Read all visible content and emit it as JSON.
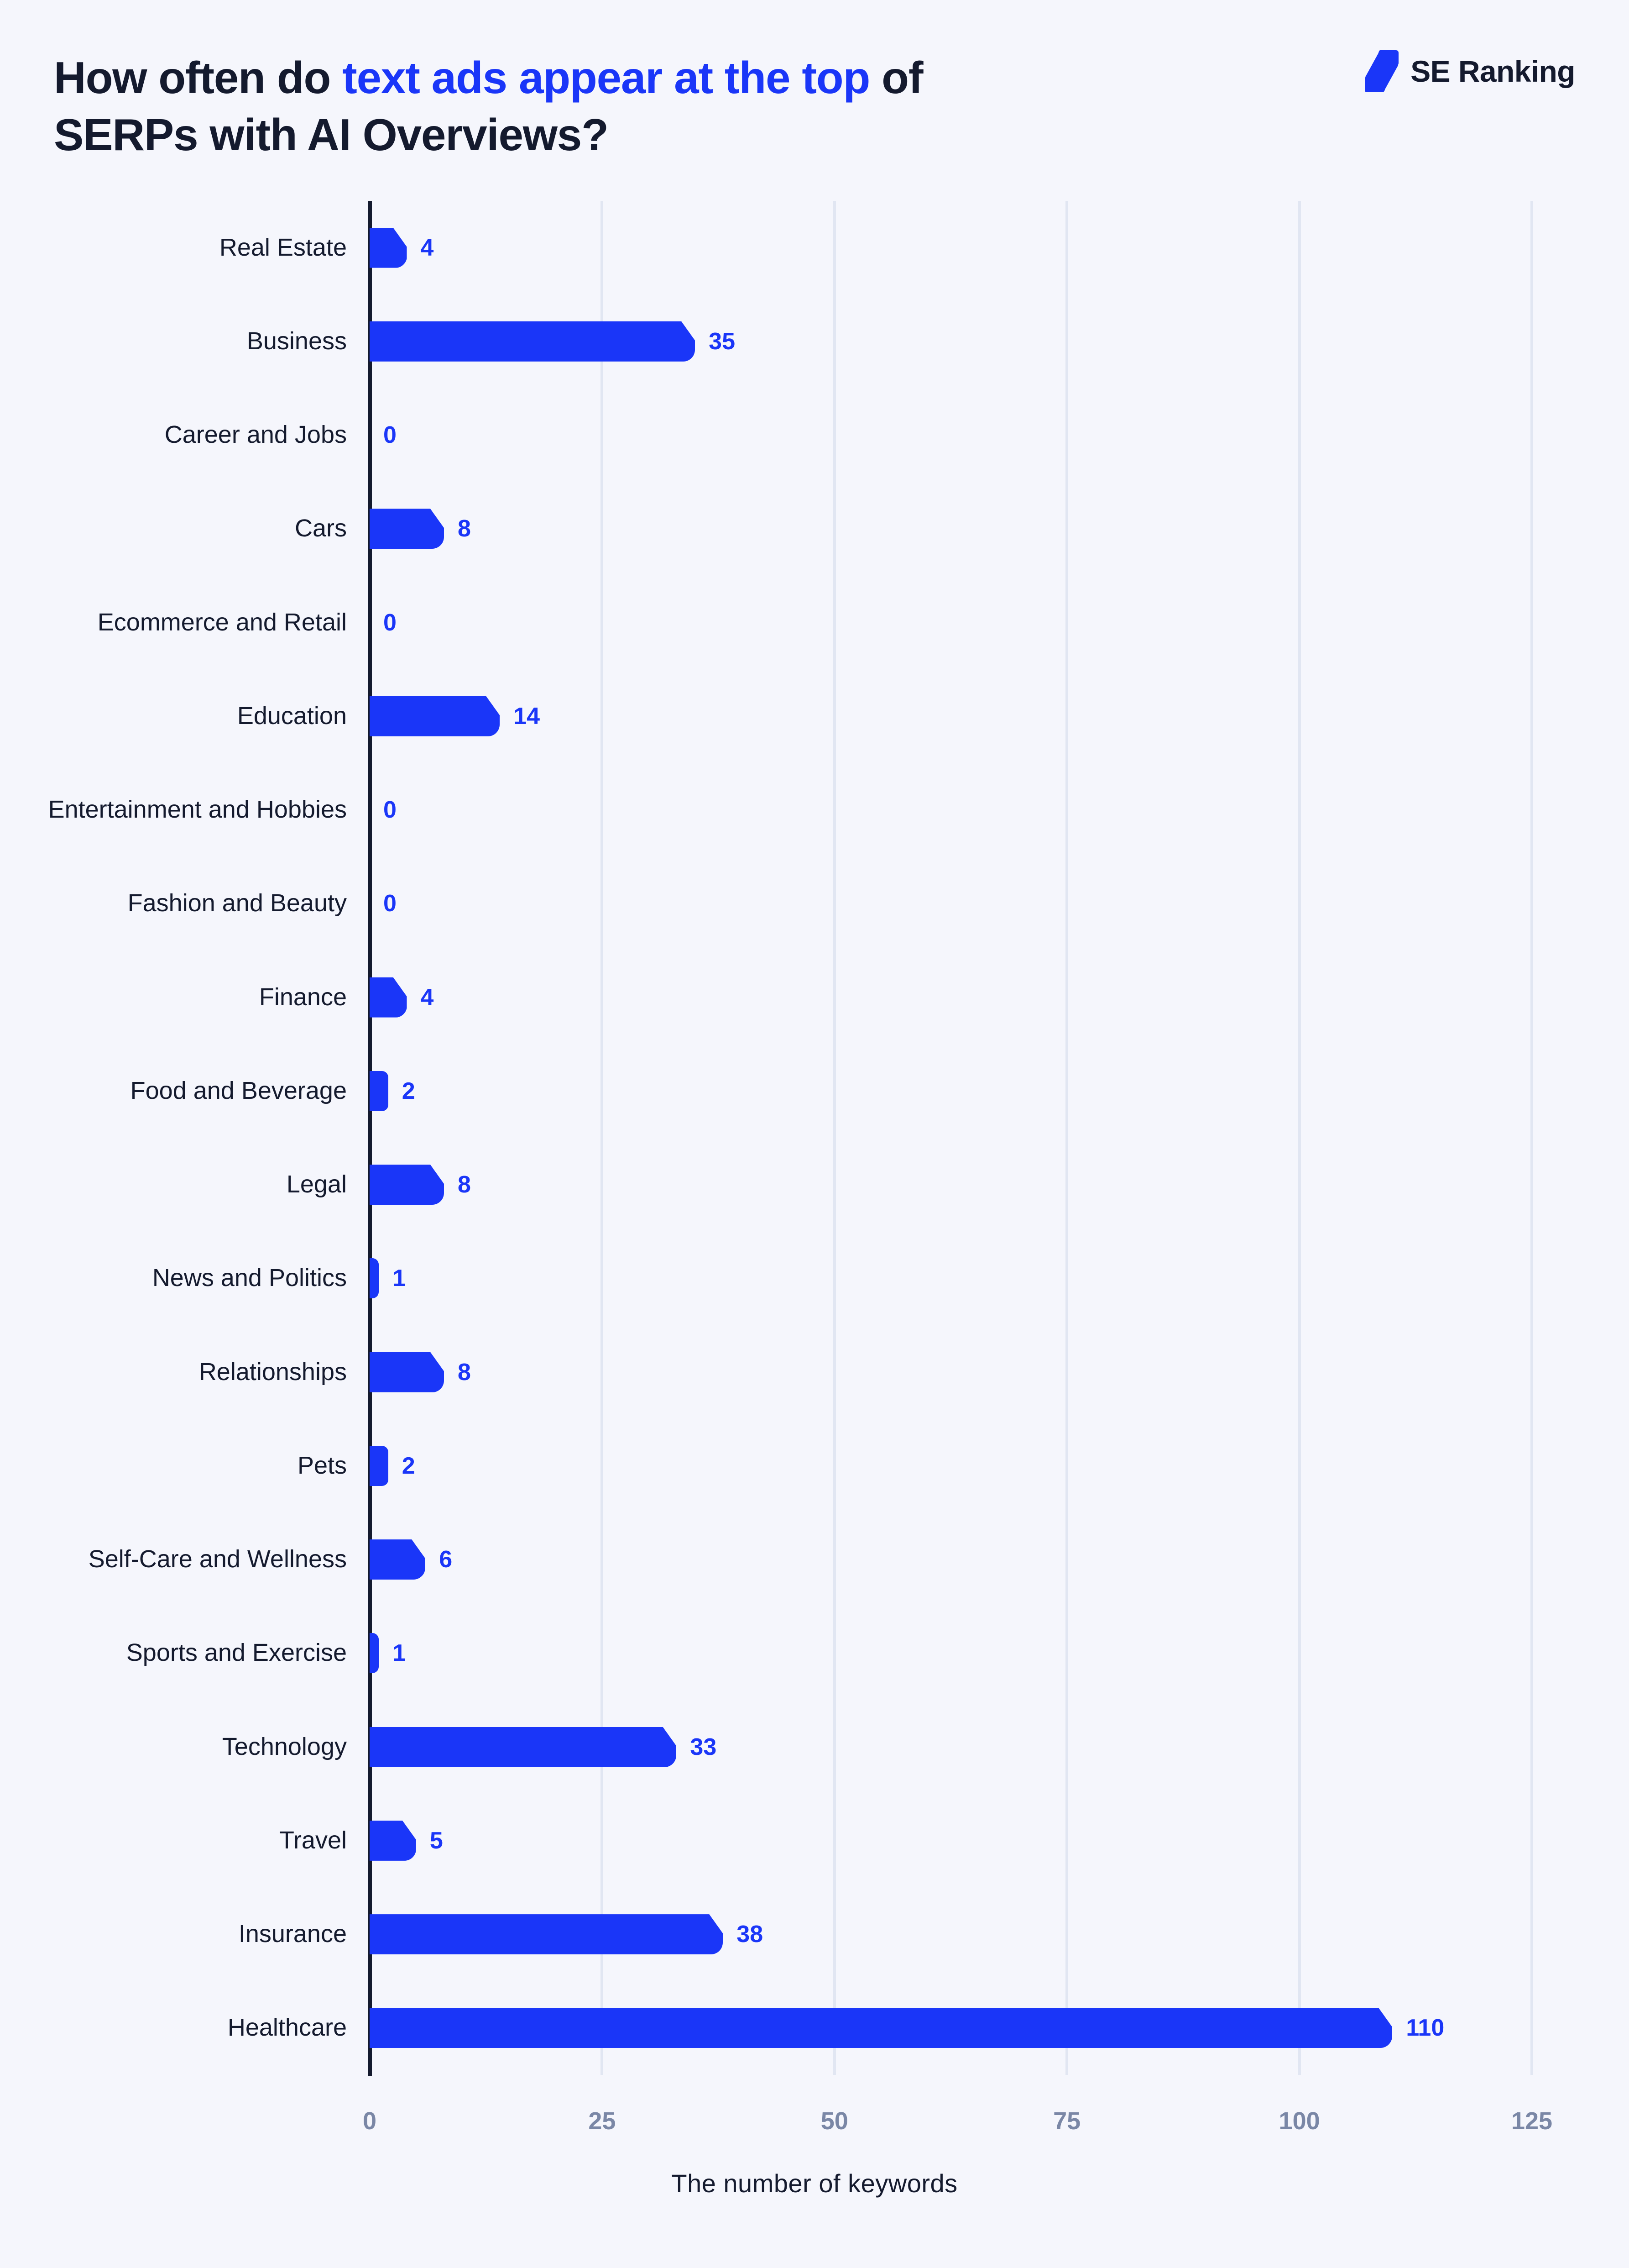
{
  "header": {
    "title_part1": "How often do ",
    "title_highlight": "text ads appear at the top",
    "title_part2": " of SERPs with AI Overviews?",
    "brand_name": "SE Ranking",
    "brand_mark_icon": "lightning-bolt-icon"
  },
  "colors": {
    "background": "#F5F6FC",
    "bar": "#1A36F8",
    "accent": "#1A36F8",
    "text_dark": "#141A2E",
    "tick_text": "#7A87A6",
    "gridline": "#E1E6F2",
    "axis": "#141A2E"
  },
  "chart_data": {
    "type": "bar",
    "orientation": "horizontal",
    "title": "How often do text ads appear at the top of SERPs with AI Overviews?",
    "xlabel": "The number of keywords",
    "ylabel": "",
    "xlim": [
      0,
      125
    ],
    "xticks": [
      0,
      25,
      50,
      75,
      100,
      125
    ],
    "xtick_labels": [
      "0",
      "25",
      "50",
      "75",
      "100",
      "125"
    ],
    "grid": true,
    "legend": false,
    "categories": [
      "Real Estate",
      "Business",
      "Career and Jobs",
      "Cars",
      "Ecommerce and Retail",
      "Education",
      "Entertainment and Hobbies",
      "Fashion and Beauty",
      "Finance",
      "Food and Beverage",
      "Legal",
      "News and Politics",
      "Relationships",
      "Pets",
      "Self-Care and Wellness",
      "Sports and Exercise",
      "Technology",
      "Travel",
      "Insurance",
      "Healthcare"
    ],
    "values": [
      4,
      35,
      0,
      8,
      0,
      14,
      0,
      0,
      4,
      2,
      8,
      1,
      8,
      2,
      6,
      1,
      33,
      5,
      38,
      110
    ],
    "value_labels": [
      "4",
      "35",
      "0",
      "8",
      "0",
      "14",
      "0",
      "0",
      "4",
      "2",
      "8",
      "1",
      "8",
      "2",
      "6",
      "1",
      "33",
      "5",
      "38",
      "110"
    ]
  }
}
